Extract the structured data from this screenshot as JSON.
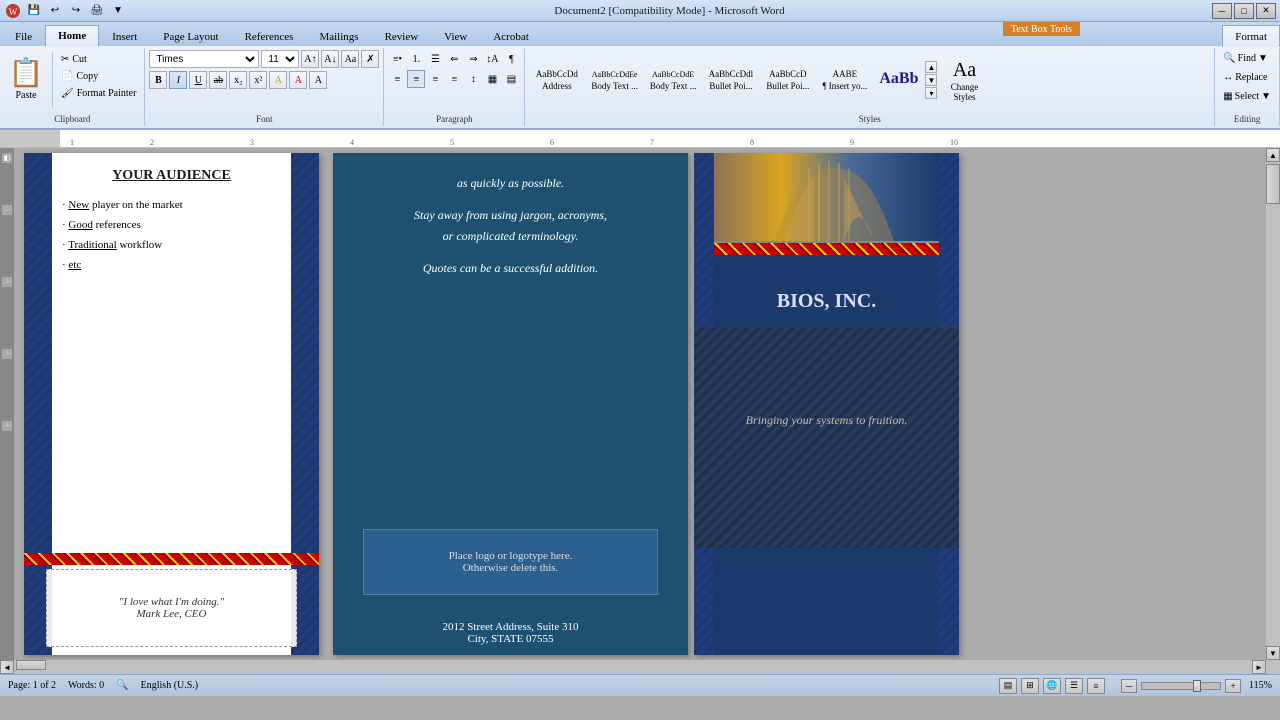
{
  "titlebar": {
    "title": "Document2 [Compatibility Mode] - Microsoft Word",
    "min_label": "─",
    "max_label": "□",
    "close_label": "✕"
  },
  "textboxtoolstab": {
    "label": "Text Box Tools"
  },
  "tabs": {
    "file_label": "File",
    "home_label": "Home",
    "insert_label": "Insert",
    "page_layout_label": "Page Layout",
    "references_label": "References",
    "mailings_label": "Mailings",
    "review_label": "Review",
    "view_label": "View",
    "acrobat_label": "Acrobat",
    "format_label": "Format"
  },
  "clipboard": {
    "paste_label": "Paste",
    "cut_label": "Cut",
    "copy_label": "Copy",
    "format_painter_label": "Format Painter",
    "group_label": "Clipboard"
  },
  "font": {
    "font_name": "Times",
    "font_size": "11",
    "bold_label": "B",
    "italic_label": "I",
    "underline_label": "U",
    "group_label": "Font"
  },
  "paragraph": {
    "group_label": "Paragraph"
  },
  "styles": {
    "group_label": "Styles",
    "style1_label": "Address",
    "style2_label": "Body Text ...",
    "style3_label": "Body Text ...",
    "style4_label": "Bullet Poi...",
    "style5_label": "Bullet Poi...",
    "style6_label": "¶ Insert yo...",
    "change_styles_label": "Change\nStyles",
    "style_preview1": "AaBbCcDd",
    "style_preview2": "AaBbCcDdEe",
    "style_preview3": "AaBbCcDdE",
    "style_preview4": "AaBbCcDdl",
    "style_preview5": "AaBbCcD",
    "style_preview6": "AABE",
    "style_preview7": "AaBb"
  },
  "editing": {
    "group_label": "Editing",
    "find_label": "Find",
    "replace_label": "Replace",
    "select_label": "Select"
  },
  "left_panel": {
    "title": "YOUR AUDIENCE",
    "bullet1": "· New player on the market",
    "bullet2": "· Good references",
    "bullet3": "· Traditional workflow",
    "bullet4": "· etc",
    "new_underline": "New",
    "good_underline": "Good",
    "traditional_underline": "Traditional",
    "etc_underline": "etc",
    "quote": "\"I love what I'm doing.\"",
    "quote_author": "Mark Lee, CEO"
  },
  "center_panel": {
    "text1": "as quickly as possible.",
    "text2": "Stay away from using jargon, acronyms,",
    "text3": "or complicated terminology.",
    "text4": "Quotes can be a successful addition.",
    "logo_text1": "Place logo  or logotype here.",
    "logo_text2": "Otherwise delete this.",
    "address1": "2012 Street Address,  Suite 310",
    "address2": "City, STATE 07555"
  },
  "right_panel": {
    "company": "BIOS, INC.",
    "tagline": "Bringing your systems to fruition."
  },
  "statusbar": {
    "page_label": "Page: 1 of 2",
    "words_label": "Words: 0",
    "lang_label": "English (U.S.)",
    "zoom_label": "115%"
  }
}
